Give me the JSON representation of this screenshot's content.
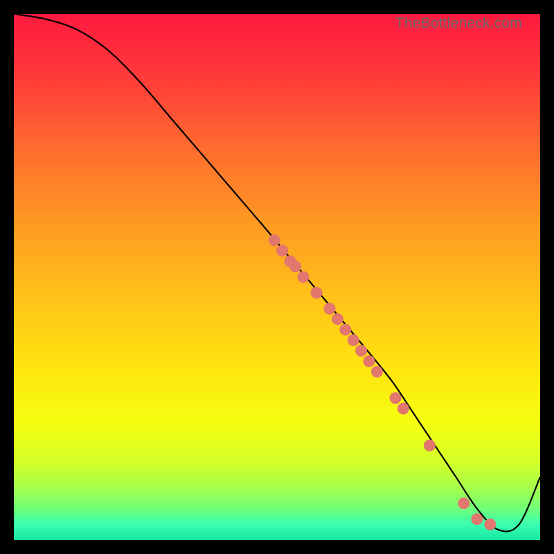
{
  "watermark": "TheBottleneck.com",
  "chart_data": {
    "type": "line",
    "title": "",
    "xlabel": "",
    "ylabel": "",
    "xlim": [
      0,
      100
    ],
    "ylim": [
      0,
      100
    ],
    "curve": {
      "name": "bottleneck-curve",
      "x": [
        0,
        6,
        12,
        18,
        24,
        30,
        36,
        42,
        48,
        53,
        58,
        63,
        68,
        72,
        76,
        80,
        84,
        88,
        92,
        96,
        100
      ],
      "y": [
        100,
        99,
        97,
        93,
        87,
        80,
        73,
        66,
        59,
        53,
        47,
        41,
        35,
        30,
        24,
        18,
        12,
        6,
        2,
        3,
        12
      ]
    },
    "series": [
      {
        "name": "data-points",
        "x": [
          49.5,
          51.0,
          52.5,
          53.5,
          55.0,
          57.5,
          60.0,
          61.5,
          63.0,
          64.5,
          66.0,
          67.5,
          69.0,
          72.5,
          74.0,
          79.0,
          85.5,
          88.0,
          90.5
        ],
        "y": [
          57.0,
          55.0,
          53.0,
          52.0,
          50.0,
          47.0,
          44.0,
          42.0,
          40.0,
          38.0,
          36.0,
          34.0,
          32.0,
          27.0,
          25.0,
          18.0,
          7.0,
          4.0,
          3.0
        ]
      }
    ],
    "colors": {
      "point_fill": "#e2776d",
      "point_stroke": "#c95b52",
      "curve": "#000000"
    },
    "background_gradient": {
      "stops": [
        {
          "offset": 0.0,
          "color": "#ff1a3f"
        },
        {
          "offset": 0.12,
          "color": "#ff3a3a"
        },
        {
          "offset": 0.25,
          "color": "#ff6a2f"
        },
        {
          "offset": 0.4,
          "color": "#ff9a22"
        },
        {
          "offset": 0.55,
          "color": "#ffc518"
        },
        {
          "offset": 0.68,
          "color": "#ffe60f"
        },
        {
          "offset": 0.78,
          "color": "#f4ff10"
        },
        {
          "offset": 0.85,
          "color": "#d4ff28"
        },
        {
          "offset": 0.9,
          "color": "#a6ff4a"
        },
        {
          "offset": 0.94,
          "color": "#6fff78"
        },
        {
          "offset": 0.97,
          "color": "#3affb0"
        },
        {
          "offset": 1.0,
          "color": "#14e6a0"
        }
      ]
    }
  }
}
